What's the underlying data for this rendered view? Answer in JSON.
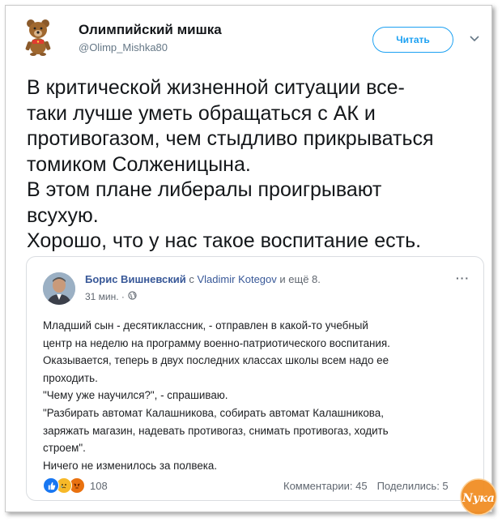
{
  "tweet": {
    "author_name": "Олимпийский мишка",
    "author_handle": "@Olimp_Mishka80",
    "follow_label": "Читать",
    "text_lines": [
      "В критической жизненной ситуации все-",
      "таки лучше уметь обращаться с АК и",
      "противогазом, чем стыдливо прикрываться",
      "томиком Солженицына.",
      "В этом плане либералы проигрывают",
      "всухую.",
      "Хорошо, что у нас такое воспитание есть."
    ]
  },
  "fb_post": {
    "author": "Борис Вишневский",
    "with_word": "с",
    "tagged": "Vladimir Kotegov",
    "and_more": "и ещё 8.",
    "time": "31 мин. ·",
    "more_label": "···",
    "body_lines": [
      "Младший сын - десятиклассник, - отправлен в какой-то учебный",
      "центр на неделю на программу военно-патриотического воспитания.",
      "Оказывается, теперь в двух последних классах школы всем надо ее",
      "проходить.",
      "\"Чему уже научился?\", - спрашиваю.",
      "\"Разбирать автомат Калашникова, собирать автомат Калашникова,",
      "заряжать магазин, надевать противогаз, снимать противогаз, ходить",
      "строем\".",
      "Ничего не изменилось за полвека."
    ],
    "reaction_count": "108",
    "comments": "Комментарии: 45",
    "shares": "Поделились: 5"
  },
  "watermark": "Nука",
  "colors": {
    "twitter_blue": "#1da1f2",
    "fb_link": "#385898",
    "like_blue": "#1877f2",
    "sad_yellow": "#f7b928",
    "angry_orange": "#e9710f",
    "watermark_orange": "#f08a1d"
  },
  "icons": [
    "olympic-bear-avatar-icon",
    "chevron-down-icon",
    "globe-icon",
    "like-reaction-icon",
    "sad-reaction-icon",
    "angry-reaction-icon"
  ]
}
